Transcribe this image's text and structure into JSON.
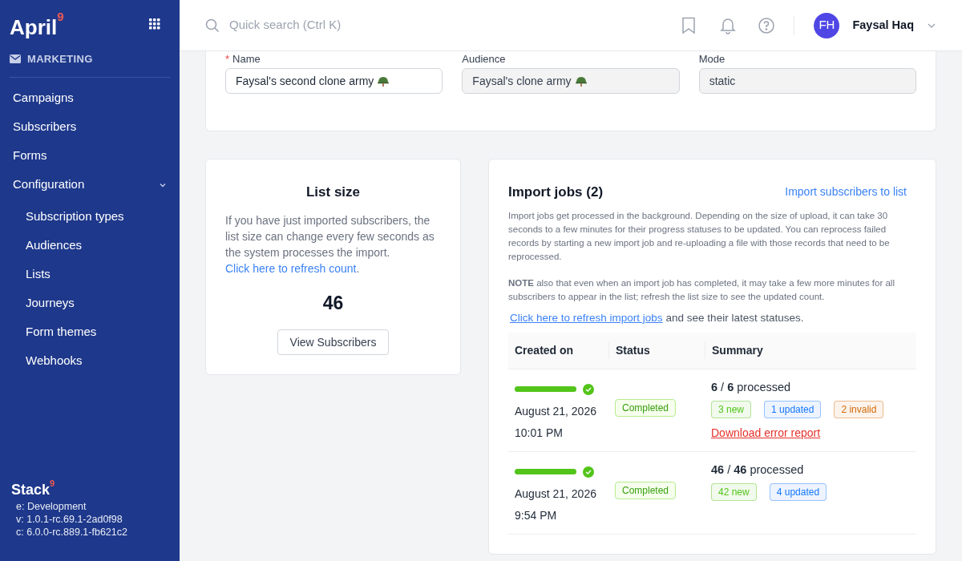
{
  "sidebar": {
    "logo": "April",
    "logo_badge": "9",
    "section": "MARKETING",
    "items": [
      {
        "label": "Campaigns"
      },
      {
        "label": "Subscribers"
      },
      {
        "label": "Forms"
      },
      {
        "label": "Configuration",
        "expanded": true,
        "children": [
          {
            "label": "Subscription types"
          },
          {
            "label": "Audiences"
          },
          {
            "label": "Lists"
          },
          {
            "label": "Journeys"
          },
          {
            "label": "Form themes"
          },
          {
            "label": "Webhooks"
          }
        ]
      }
    ],
    "footer": {
      "brand": "Stack",
      "brand_badge": "9",
      "lines": [
        "e: Development",
        "v: 1.0.1-rc.69.1-2ad0f98",
        "c: 6.0.0-rc.889.1-fb621c2"
      ]
    }
  },
  "header": {
    "search_placeholder": "Quick search (Ctrl K)",
    "user": {
      "initials": "FH",
      "name": "Faysal Haq"
    }
  },
  "form": {
    "fields": [
      {
        "label": "Name",
        "required_mark": "*",
        "value": "Faysal's second clone army",
        "disabled": false
      },
      {
        "label": "Audience",
        "value": "Faysal's clone army",
        "disabled": true
      },
      {
        "label": "Mode",
        "value": "static",
        "disabled": true
      }
    ]
  },
  "list_size": {
    "title": "List size",
    "text": "If you have just imported subscribers, the list size can change every few seconds as the system processes the import.",
    "link": "Click here to refresh count",
    "after_link": ".",
    "count": "46",
    "button": "View Subscribers"
  },
  "import_jobs": {
    "title": "Import jobs (2)",
    "action": "Import subscribers to list",
    "description": "Import jobs get processed in the background. Depending on the size of upload, it can take 30 seconds to a few minutes for their progress statuses to be updated. You can reprocess failed records by starting a new import job and re-uploading a file with those records that need to be reprocessed.",
    "note": "**NOTE** also that even when an import job has completed, it may take a few more minutes for all subscribers to appear in the list; refresh the list size to see the updated count.",
    "refresh_link": "Click here to refresh import jobs",
    "refresh_after": "and see their latest statuses.",
    "columns": [
      "Created on",
      "Status",
      "Summary"
    ],
    "rows": [
      {
        "level": 1,
        "date": "August 21, 2026",
        "time": "10:01 PM",
        "status": "Completed",
        "processed": "**6** / **6** processed",
        "tags": [
          {
            "label": "3 new",
            "color": "#52c41a"
          },
          {
            "label": "1 updated",
            "color": "#1677ff"
          },
          {
            "label": "2 invalid",
            "color": "#d46b08"
          }
        ],
        "error_link": "Download error report"
      },
      {
        "level": 1,
        "date": "August 21, 2026",
        "time": "9:54 PM",
        "status": "Completed",
        "processed": "**46** / **46** processed",
        "tags": [
          {
            "label": "42 new",
            "color": "#52c41a"
          },
          {
            "label": "4 updated",
            "color": "#1677ff"
          }
        ]
      }
    ]
  }
}
